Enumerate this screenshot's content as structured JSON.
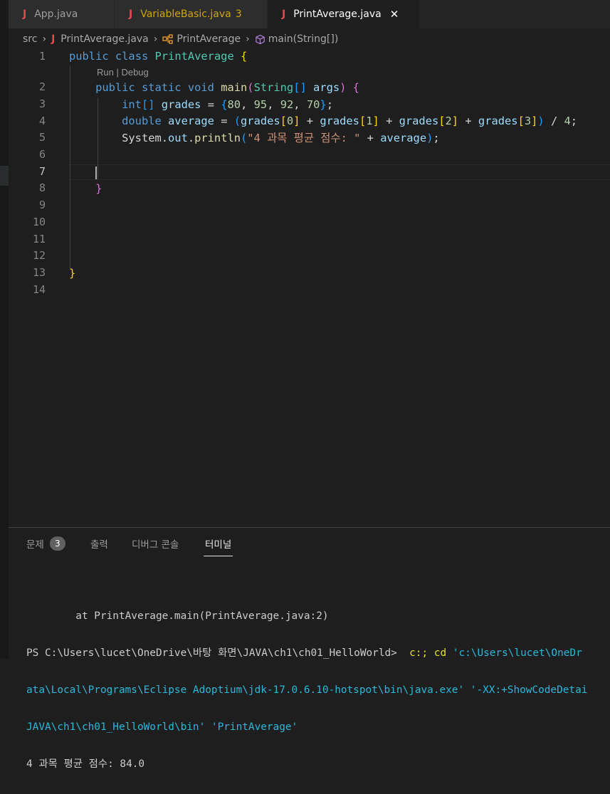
{
  "tabs": [
    {
      "label": "App.java",
      "icon": "java-icon",
      "state": "normal"
    },
    {
      "label": "VariableBasic.java",
      "count": "3",
      "icon": "java-icon",
      "state": "warning"
    },
    {
      "label": "PrintAverage.java",
      "icon": "java-icon",
      "state": "active",
      "close": "✕"
    }
  ],
  "breadcrumb": {
    "folder": "src",
    "file": "PrintAverage.java",
    "class": "PrintAverage",
    "method": "main(String[])"
  },
  "editor": {
    "codelens": "Run | Debug",
    "current_line": 7,
    "line_numbers": [
      "1",
      "2",
      "3",
      "4",
      "5",
      "6",
      "7",
      "8",
      "9",
      "10",
      "11",
      "12",
      "13",
      "14"
    ],
    "lines": [
      "public class PrintAverage {",
      "    public static void main(String[] args) {",
      "        int[] grades = {80, 95, 92, 70};",
      "        double average = (grades[0] + grades[1] + grades[2] + grades[3]) / 4;",
      "        System.out.println(\"4 과목 평균 점수: \" + average);",
      "",
      "",
      "    }",
      "",
      "",
      "",
      "",
      "}",
      ""
    ]
  },
  "panel": {
    "tabs": [
      {
        "label": "문제",
        "badge": "3"
      },
      {
        "label": "출력"
      },
      {
        "label": "디버그 콘솔"
      },
      {
        "label": "터미널",
        "active": true
      }
    ],
    "terminal": {
      "line1": "        at PrintAverage.main(PrintAverage.java:2)",
      "line2_prompt": "PS C:\\Users\\lucet\\OneDrive\\바탕 화면\\JAVA\\ch1\\ch01_HelloWorld>  ",
      "line2_cmd": "c:; cd",
      "line2_arg": " 'c:\\Users\\lucet\\OneDr",
      "line3": "ata\\Local\\Programs\\Eclipse Adoptium\\jdk-17.0.6.10-hotspot\\bin\\java.exe' '-XX:+ShowCodeDetai",
      "line4": "JAVA\\ch1\\ch01_HelloWorld\\bin' 'PrintAverage'",
      "line5": "4 과목 평균 점수: 84.0"
    }
  },
  "colors": {
    "java_icon": "#e8484a",
    "warning": "#cca700",
    "keyword": "#569cd6",
    "type": "#4ec9b0",
    "string": "#ce9178",
    "number": "#b5cea8"
  }
}
